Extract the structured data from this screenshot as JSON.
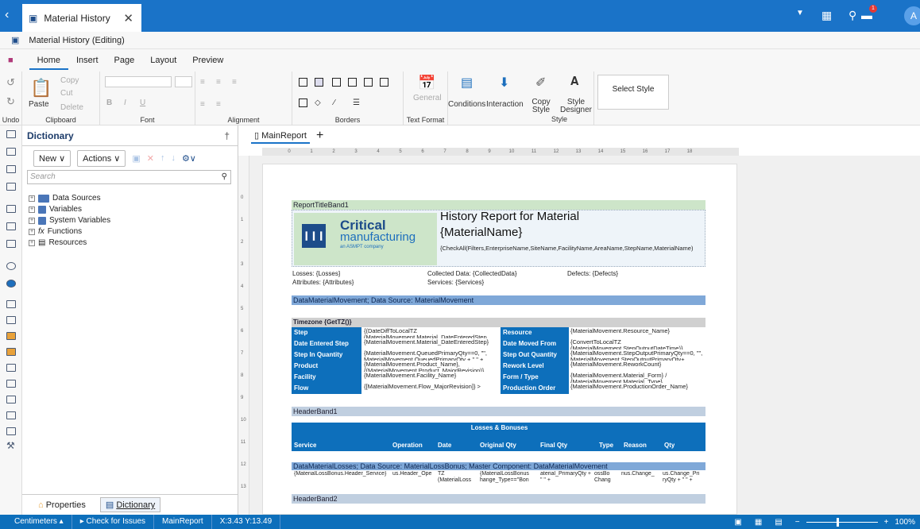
{
  "topbar": {
    "tab_title": "Material History",
    "avatar_initial": "A",
    "notif_count": "1"
  },
  "doc": {
    "title": "Material History (Editing)"
  },
  "menu": {
    "items": [
      "Home",
      "Insert",
      "Page",
      "Layout",
      "Preview"
    ]
  },
  "ribbon": {
    "clipboard": {
      "copy": "Copy",
      "cut": "Cut",
      "paste": "Paste",
      "delete": "Delete",
      "label": "Clipboard"
    },
    "undo_label": "Undo",
    "font_label": "Font",
    "alignment_label": "Alignment",
    "borders_label": "Borders",
    "text_format": {
      "general": "General",
      "label": "Text Format"
    },
    "conditions": "Conditions",
    "interaction": "Interaction",
    "copy_style": "Copy Style",
    "style_designer": "Style Designer",
    "select_style": "Select Style",
    "style_label": "Style"
  },
  "dict": {
    "title": "Dictionary",
    "new_label": "New",
    "actions_label": "Actions",
    "search_placeholder": "Search",
    "tree": [
      "Data Sources",
      "Variables",
      "System Variables",
      "Functions",
      "Resources"
    ],
    "properties_tab": "Properties",
    "dictionary_tab": "Dictionary"
  },
  "report": {
    "tab": "MainReport",
    "ruler": [
      "0",
      "1",
      "2",
      "3",
      "4",
      "5",
      "6",
      "7",
      "8",
      "9",
      "10",
      "11",
      "12",
      "13",
      "14",
      "15",
      "16",
      "17",
      "18"
    ],
    "vruler": [
      "0",
      "1",
      "2",
      "3",
      "4",
      "5",
      "6",
      "7",
      "8",
      "9",
      "10",
      "11",
      "12",
      "13"
    ],
    "band_title": "ReportTitleBand1",
    "logo": {
      "l1": "Critical",
      "l2": "manufacturing",
      "l3": "an ASMPT company"
    },
    "heading1": "History Report for Material",
    "heading2": "{MaterialName}",
    "filters": "{CheckAll(Filters,EnterpriseName,SiteName,FacilityName,AreaName,StepName,MaterialName)",
    "losses": "Losses: {Losses}",
    "collected": "Collected Data: {CollectedData}",
    "defects": "Defects: {Defects}",
    "attributes": "Attributes: {Attributes}",
    "services": "Services: {Services}",
    "data_band": "DataMaterialMovement; Data Source: MaterialMovement",
    "timezone": "Timezone {GetTZ()}",
    "left_labels": [
      "Step",
      "Date Entered Step",
      "Step In Quantity",
      "Product",
      "Facility",
      "Flow"
    ],
    "left_values": [
      "{(DateDiffToLocalTZ (MaterialMovement.Material_DateEnteredStep",
      "{MaterialMovement.Material_DateEnteredStep}",
      "{MaterialMovement.QueuedPrimaryQty==0, \"\", MaterialMovement.QueuedPrimaryQty + \" \" +",
      "{MaterialMovement.Product_Name}, {(MaterialMovement.Product_MajorRevision)}",
      "{MaterialMovement.Facility_Name}",
      "{[MaterialMovement.Flow_MajorRevision]} >"
    ],
    "right_labels": [
      "Resource",
      "Date Moved From",
      "Step Out Quantity",
      "Rework Level",
      "Form / Type",
      "Production Order"
    ],
    "right_values": [
      "{MaterialMovement.Resource_Name}",
      "{ConvertToLocalTZ (MaterialMovement.StepOutputDateTime)}",
      "{MaterialMovement.StepOutputPrimaryQty==0, \"\", MaterialMovement.StepOutputPrimaryQty+",
      "{MaterialMovement.ReworkCount}",
      "{MaterialMovement.Material_Form} / {MaterialMovement.Material_Type}",
      "{MaterialMovement.ProductionOrder_Name}"
    ],
    "header_band1": "HeaderBand1",
    "losses_header": "Losses & Bonuses",
    "columns": [
      "Service",
      "Operation",
      "Date",
      "Original Qty",
      "Final Qty",
      "Type",
      "Reason",
      "Qty"
    ],
    "losses_band": "DataMaterialLosses; Data Source: MaterialLossBonus; Master Component: DataMaterialMovement",
    "loss_cells": [
      "{MaterialLossBonus.Header_Service}",
      "us.Header_Ope",
      "TZ (MaterialLoss",
      "{MaterialLossBonus hange_Type==\"Bon",
      "aterial_PrimaryQty + \" \" +",
      "ossBo Chang",
      "nus.Change_",
      "us.Change_Pri ryQty + \" \" +"
    ],
    "header_band2": "HeaderBand2"
  },
  "status": {
    "units": "Centimeters",
    "check": "Check for Issues",
    "report": "MainReport",
    "coords": "X:3.43 Y:13.49",
    "zoom": "100%"
  }
}
